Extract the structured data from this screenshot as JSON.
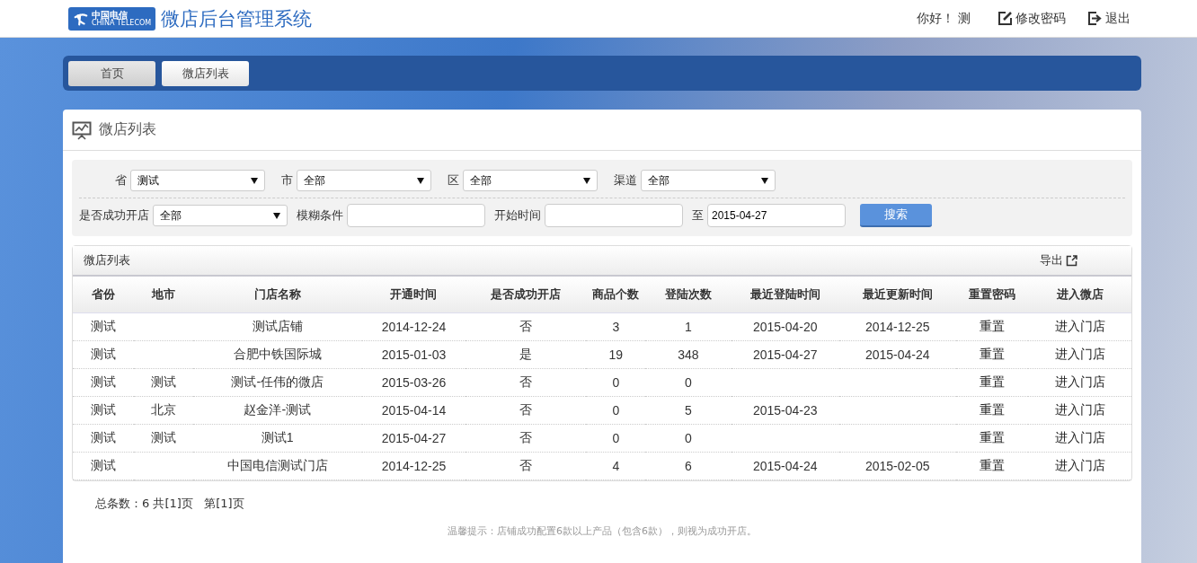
{
  "header": {
    "logo": {
      "name": "中国电信",
      "sub": "CHINA TELECOM"
    },
    "title": "微店后台管理系统",
    "greeting": "你好！",
    "user": "测",
    "links": [
      {
        "kind": "edit",
        "label": "修改密码"
      },
      {
        "kind": "logout",
        "label": "退出"
      }
    ]
  },
  "nav": [
    {
      "label": "首页",
      "selected": true
    },
    {
      "label": "微店列表",
      "selected": false
    }
  ],
  "panel": {
    "title": "微店列表"
  },
  "filters": [
    [
      {
        "kind": "select",
        "label": "省",
        "value": "测试"
      },
      {
        "kind": "select",
        "label": "市",
        "value": "全部"
      },
      {
        "kind": "select",
        "label": "区",
        "value": "全部"
      },
      {
        "kind": "select",
        "label": "渠道",
        "value": "全部"
      }
    ],
    [
      {
        "kind": "select",
        "label": "是否成功开店",
        "value": "全部"
      },
      {
        "kind": "input",
        "label": "模糊条件"
      },
      {
        "kind": "input",
        "label": "开始时间"
      },
      {
        "kind": "input",
        "label": "至",
        "value": "2015-04-27"
      },
      {
        "kind": "button",
        "label": "搜索"
      }
    ]
  ],
  "table": {
    "title": "微店列表",
    "export": "导出",
    "columns": [
      {
        "label": "省份",
        "kind": "text"
      },
      {
        "label": "地市",
        "kind": "text"
      },
      {
        "label": "门店名称",
        "kind": "text"
      },
      {
        "label": "开通时间",
        "kind": "text"
      },
      {
        "label": "是否成功开店",
        "kind": "text"
      },
      {
        "label": "商品个数",
        "kind": "text"
      },
      {
        "label": "登陆次数",
        "kind": "text"
      },
      {
        "label": "最近登陆时间",
        "kind": "text"
      },
      {
        "label": "最近更新时间",
        "kind": "text"
      },
      {
        "label": "重置密码",
        "kind": "link"
      },
      {
        "label": "进入微店",
        "kind": "link"
      }
    ],
    "rows": [
      [
        "测试",
        "",
        "测试店铺",
        "2014-12-24",
        "否",
        "3",
        "1",
        "2015-04-20",
        "2014-12-25",
        "重置",
        "进入门店"
      ],
      [
        "测试",
        "",
        "合肥中铁国际城",
        "2015-01-03",
        "是",
        "19",
        "348",
        "2015-04-27",
        "2015-04-24",
        "重置",
        "进入门店"
      ],
      [
        "测试",
        "测试",
        "测试-任伟的微店",
        "2015-03-26",
        "否",
        "0",
        "0",
        "",
        "",
        "重置",
        "进入门店"
      ],
      [
        "测试",
        "北京",
        "赵金洋-测试",
        "2015-04-14",
        "否",
        "0",
        "5",
        "2015-04-23",
        "",
        "重置",
        "进入门店"
      ],
      [
        "测试",
        "测试",
        "测试1",
        "2015-04-27",
        "否",
        "0",
        "0",
        "",
        "",
        "重置",
        "进入门店"
      ],
      [
        "测试",
        "",
        "中国电信测试门店",
        "2014-12-25",
        "否",
        "4",
        "6",
        "2015-04-24",
        "2015-02-05",
        "重置",
        "进入门店"
      ]
    ]
  },
  "pagination": "总条数：6 共[1]页   第[1]页",
  "tip": "温馨提示：店铺成功配置6款以上产品（包含6款），则视为成功开店。"
}
